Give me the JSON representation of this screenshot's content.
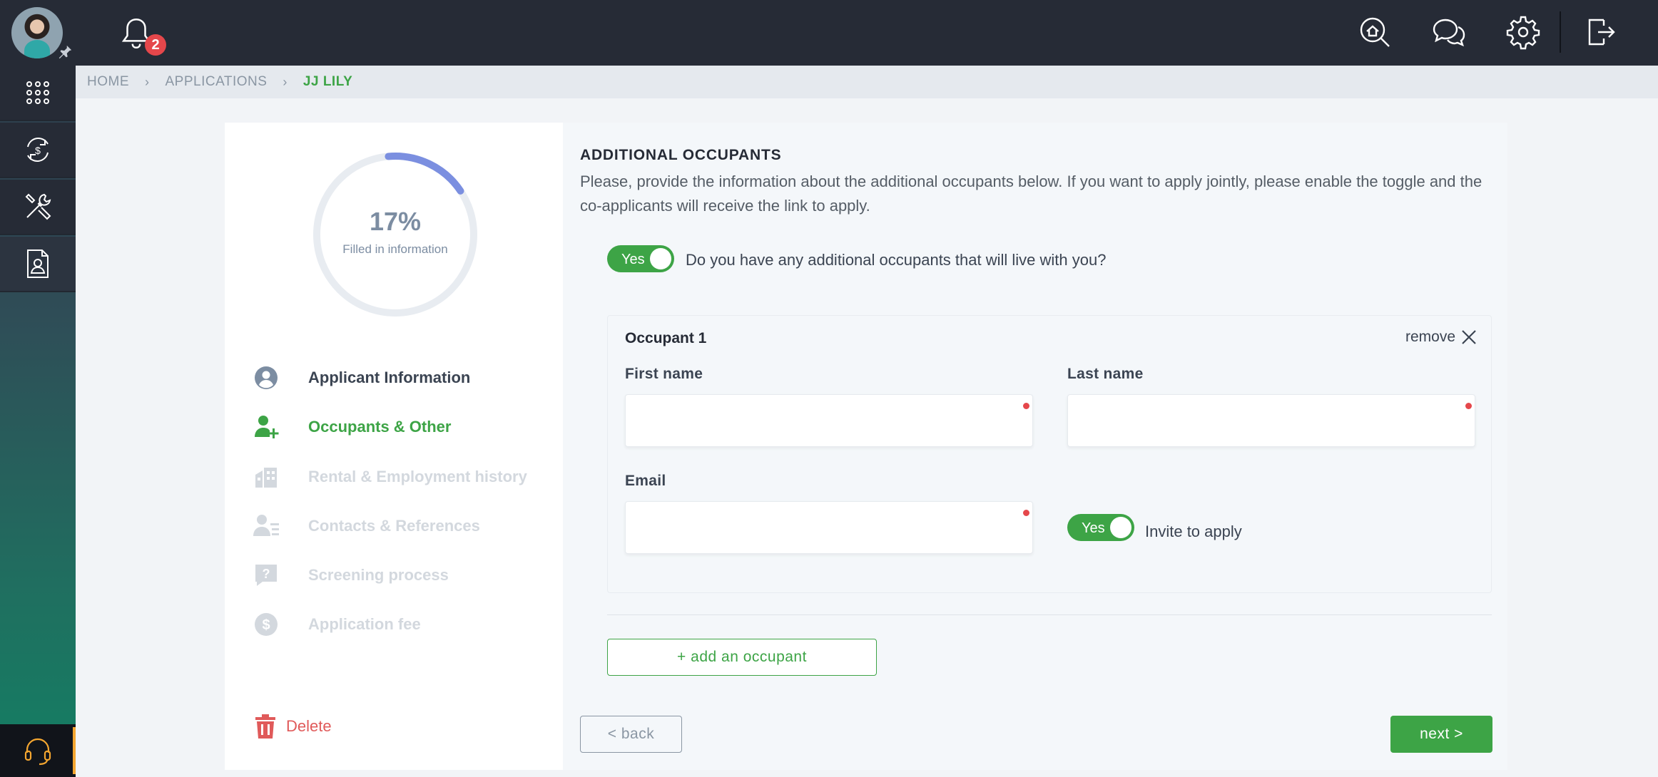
{
  "topbar": {
    "notifications_count": "2",
    "icons": [
      "user-avatar",
      "pin-icon",
      "bell-icon",
      "home-search-icon",
      "chat-icon",
      "gear-icon",
      "logout-icon"
    ]
  },
  "sidebar": {
    "items": [
      {
        "icon": "apps-grid-icon"
      },
      {
        "icon": "money-cycle-icon"
      },
      {
        "icon": "tools-icon"
      },
      {
        "icon": "document-user-icon",
        "active": true
      }
    ],
    "support_icon": "headset-icon"
  },
  "breadcrumb": {
    "items": [
      "HOME",
      "APPLICATIONS",
      "JJ LILY"
    ]
  },
  "progress": {
    "percent_label": "17%",
    "percent_value": 17,
    "caption": "Filled in information",
    "color": "#7b8fe0"
  },
  "steps": [
    {
      "label": "Applicant Information",
      "state": "done",
      "icon": "user-circle-icon"
    },
    {
      "label": "Occupants & Other",
      "state": "current",
      "icon": "user-plus-icon"
    },
    {
      "label": "Rental & Employment history",
      "state": "todo",
      "icon": "building-icon"
    },
    {
      "label": "Contacts & References",
      "state": "todo",
      "icon": "contact-list-icon"
    },
    {
      "label": "Screening process",
      "state": "todo",
      "icon": "question-bubble-icon"
    },
    {
      "label": "Application fee",
      "state": "todo",
      "icon": "dollar-circle-icon"
    }
  ],
  "delete_label": "Delete",
  "section": {
    "title": "ADDITIONAL OCCUPANTS",
    "description": "Please, provide the information about the additional occupants below. If you want to apply jointly, please enable the toggle and the co-applicants will receive the link to apply.",
    "toggle_label": "Yes",
    "question": "Do you have any additional occupants that will live with you?"
  },
  "occupant": {
    "title": "Occupant 1",
    "remove_label": "remove",
    "first_name_label": "First name",
    "first_name_value": "",
    "last_name_label": "Last name",
    "last_name_value": "",
    "email_label": "Email",
    "email_value": "",
    "invite_toggle_label": "Yes",
    "invite_text": "Invite to apply"
  },
  "buttons": {
    "add_occupant": "+ add an occupant",
    "back": "< back",
    "next": "next >"
  },
  "colors": {
    "accent_green": "#3da446",
    "topbar": "#262b36",
    "error_red": "#e5474b"
  }
}
